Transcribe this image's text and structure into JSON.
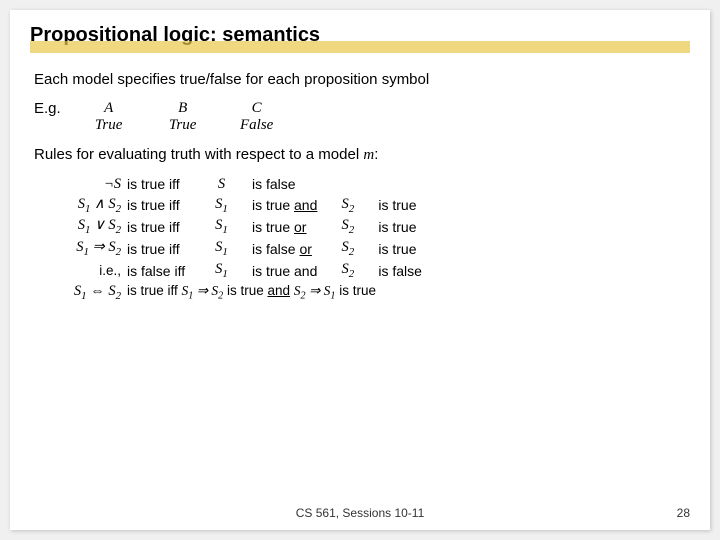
{
  "slide": {
    "title": "Propositional logic: semantics",
    "line1": "Each model specifies true/false for each proposition symbol",
    "eg_label": "E.g.",
    "eg_vars": [
      "A",
      "B",
      "C"
    ],
    "eg_vals": [
      "True",
      "True",
      "False"
    ],
    "rules_intro": "Rules for evaluating truth with respect to a model m:",
    "rules": [
      {
        "formula": "¬S",
        "iff": "is true iff",
        "s1": "S",
        "cond": "is false",
        "s2": "",
        "rest": ""
      },
      {
        "formula": "S₁ ∧ S₂",
        "iff": "is true iff",
        "s1": "S₁",
        "cond": "is true",
        "condUnder": "and",
        "s2": "S₂",
        "rest": "is true"
      },
      {
        "formula": "S₁ ∨ S₂",
        "iff": "is true iff",
        "s1": "S₁",
        "cond": "is true",
        "condUnder": "or",
        "s2": "S₂",
        "rest": "is true"
      },
      {
        "formula": "S₁ ⇒ S₂",
        "iff": "is true iff",
        "s1": "S₁",
        "cond": "is false",
        "condUnder": "or",
        "s2": "S₂",
        "rest": "is true"
      },
      {
        "formula": "i.e.,",
        "iff": "is false iff",
        "s1": "S₁",
        "cond": "is true and",
        "condUnder": "",
        "s2": "S₂",
        "rest": "is false"
      },
      {
        "formula": "S₁ ⇔ S₂",
        "iff": "is true iff S₁ ⇒ S₂ is true",
        "s1": "",
        "cond": "and",
        "condUnder": "and",
        "s2": "S₂ ⇒ S₁",
        "rest": "is true"
      }
    ],
    "footer": "CS 561, Sessions 10-11",
    "page": "28"
  }
}
